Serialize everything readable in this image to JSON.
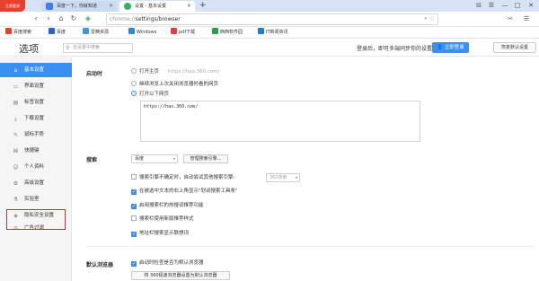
{
  "browser": {
    "badge": "立即登录",
    "tabs": [
      {
        "title": "百度一下，你就知道"
      },
      {
        "title": "设置 - 基本设置"
      }
    ],
    "new_tab": "+",
    "window_controls": [
      "⊟",
      "☰",
      "—",
      "□",
      "✕"
    ]
  },
  "nav": {
    "back": "‹",
    "forward": "›",
    "reload": "↻",
    "home": "⌂",
    "address_prefix": "chrome://",
    "address_path": "settings/browser",
    "right_tools": [
      "✂",
      "☰"
    ]
  },
  "bookmarks": [
    {
      "label": "百度搜索",
      "color": "#e8402f"
    },
    {
      "label": "百度",
      "color": "#2a62d8"
    },
    {
      "label": "爱精资源",
      "color": "#3a9ad9"
    },
    {
      "label": "Windows",
      "color": "#2b88d8"
    },
    {
      "label": "pdf下载",
      "color": "#e23c3c"
    },
    {
      "label": "西西软件园",
      "color": "#2c9e4b"
    },
    {
      "label": "IT新闻资讯",
      "color": "#1c7cd6"
    }
  ],
  "settings_header": {
    "title": "选项",
    "search_placeholder": "在设置中搜索",
    "sync_text": "登录后，即可多端同步你的设置",
    "login_button": "立即登录",
    "restore_button": "恢复默认设置"
  },
  "sidebar": {
    "items": [
      {
        "label": "基本设置",
        "icon": "home-icon",
        "active": true
      },
      {
        "label": "界面设置",
        "icon": "layout-icon"
      },
      {
        "label": "标签设置",
        "icon": "tab-icon"
      },
      {
        "label": "下载设置",
        "icon": "download-icon"
      },
      {
        "label": "鼠标手势",
        "icon": "mouse-icon"
      },
      {
        "label": "快捷键",
        "icon": "keyboard-icon"
      },
      {
        "label": "个人资料",
        "icon": "user-icon"
      },
      {
        "label": "高级设置",
        "icon": "gear-icon"
      },
      {
        "label": "实验室",
        "icon": "flask-icon"
      },
      {
        "label": "隐私安全设置",
        "icon": "shield-icon"
      },
      {
        "label": "广告过滤",
        "icon": "block-icon"
      }
    ]
  },
  "startup": {
    "label": "启动时",
    "option_home": "打开主页",
    "home_url": "https://hao.360.com/",
    "option_continue": "继续浏览上次关闭浏览器时看的网页",
    "option_pages": "打开以下网页",
    "pages_value": "https://hao.360.com/"
  },
  "search": {
    "label": "搜索",
    "engine": "百度",
    "manage_button": "管理搜索引擎...",
    "opt_fallback": "搜索引擎不确定时，自动尝试其他搜索引擎:",
    "fallback_engine": "360搜索",
    "opt_toolbar": "在被选中文本的右上角显示\"划词搜索工具条\"",
    "opt_hot": "启用搜索栏的热搜词推荐功能",
    "opt_newtab": "搜索栏使用新版推荐样式",
    "opt_suggest": "地址栏搜索显示联想词"
  },
  "default_browser": {
    "label": "默认浏览器",
    "opt_check": "启动时检查是否为默认浏览器",
    "set_button": "将 360极速浏览器设置为默认浏览器"
  }
}
